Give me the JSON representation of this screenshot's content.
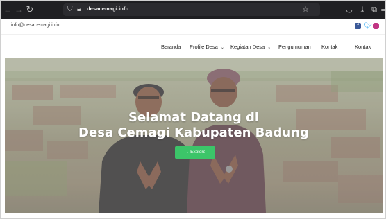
{
  "browser": {
    "url": "desacemagi.info",
    "icons": [
      "back-arrow-icon",
      "forward-arrow-icon",
      "reload-icon",
      "shield-icon",
      "lock-icon",
      "star-icon",
      "pocket-icon",
      "download-icon",
      "extensions-icon",
      "menu-icon"
    ]
  },
  "topbar": {
    "email": "info@desacemagi.info",
    "social": [
      "facebook-icon",
      "twitter-icon",
      "instagram-icon"
    ],
    "colors": {
      "facebook": "#3b5998",
      "twitter": "#1da1f2",
      "instagram": "#c13584"
    }
  },
  "nav": {
    "items": [
      {
        "label": "Beranda",
        "dropdown": false
      },
      {
        "label": "Profile Desa",
        "dropdown": true
      },
      {
        "label": "Kegiatan Desa",
        "dropdown": true
      },
      {
        "label": "Pengumuman",
        "dropdown": false
      },
      {
        "label": "Kontak",
        "dropdown": false
      },
      {
        "label": "Kontak",
        "dropdown": false
      }
    ]
  },
  "hero": {
    "title_line1": "Selamat Datang di",
    "title_line2": "Desa Cemagi Kabupaten Badung",
    "button_label": "→ Explore",
    "button_color": "#3cc569"
  }
}
